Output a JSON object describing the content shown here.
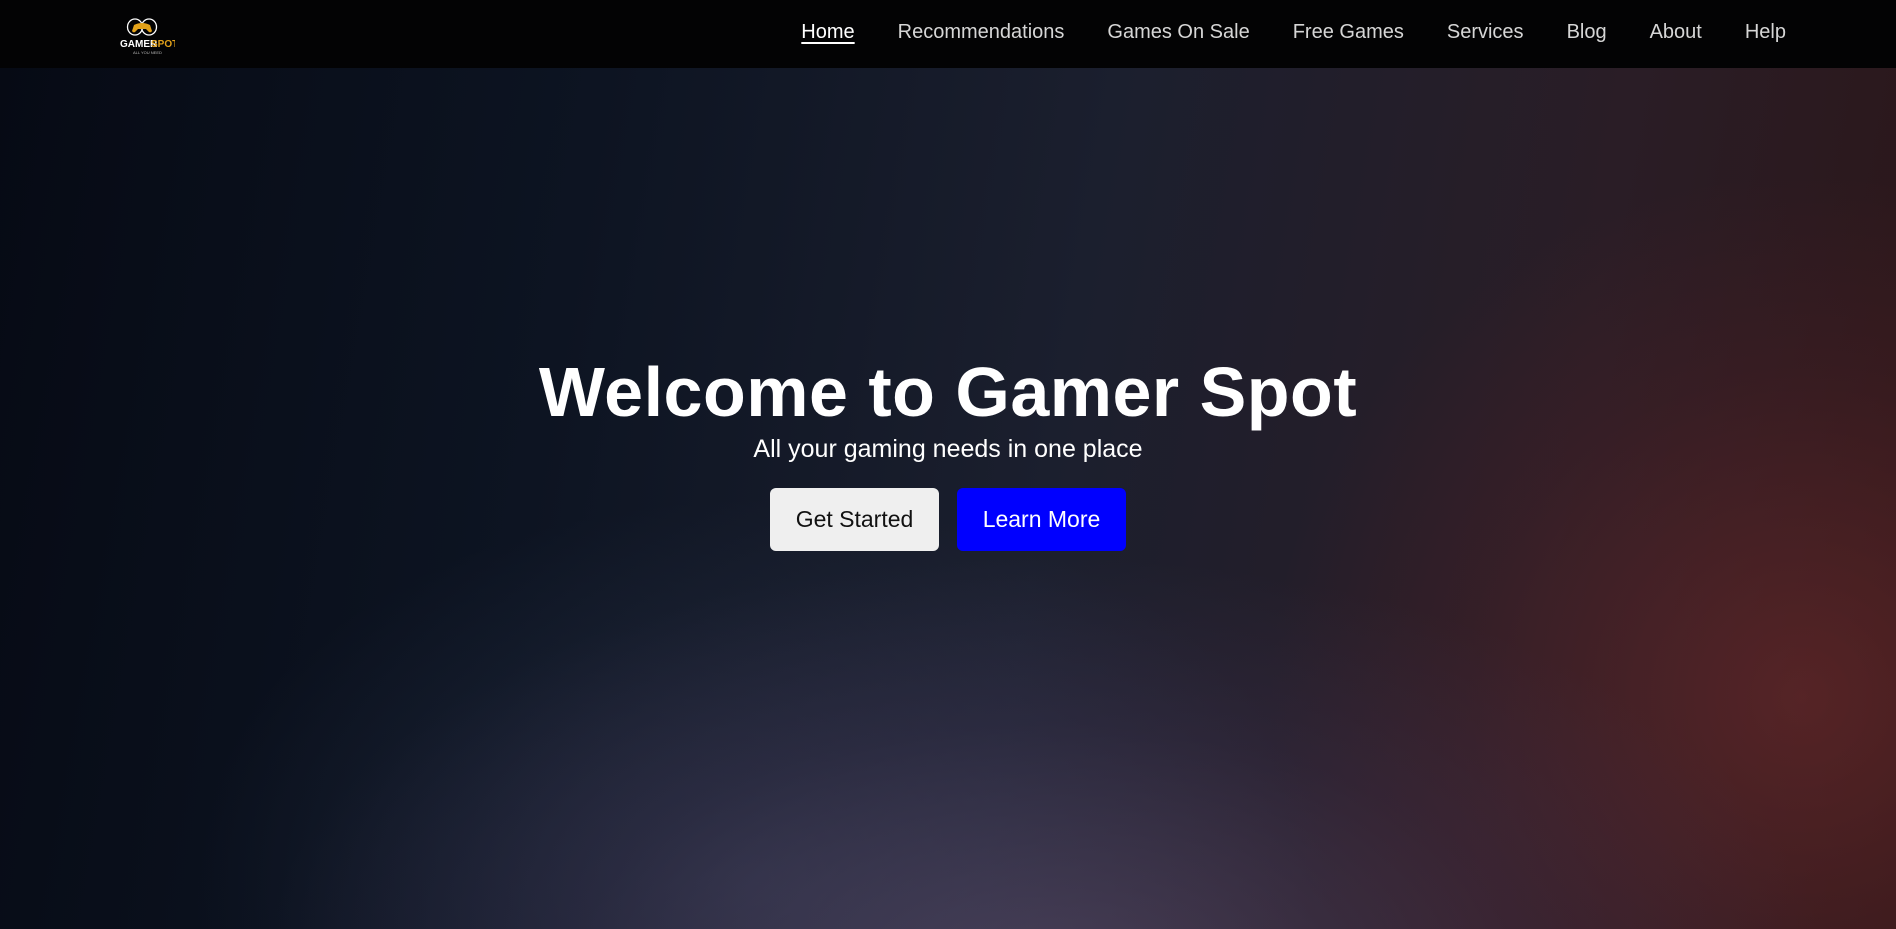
{
  "brand": {
    "logo_icon": "game-controller-icon",
    "logo_text_primary": "GAMER",
    "logo_text_accent": "SPOT",
    "logo_tagline": "ALL YOU NEED",
    "accent_color": "#e3a21a"
  },
  "nav": {
    "items": [
      {
        "label": "Home",
        "active": true
      },
      {
        "label": "Recommendations"
      },
      {
        "label": "Games On Sale"
      },
      {
        "label": "Free Games"
      },
      {
        "label": "Services"
      },
      {
        "label": "Blog"
      },
      {
        "label": "About"
      },
      {
        "label": "Help"
      }
    ]
  },
  "hero": {
    "title": "Welcome to Gamer Spot",
    "subtitle": "All your gaming needs in one place",
    "primary_button": "Get Started",
    "secondary_button": "Learn More",
    "secondary_button_color": "#0000ff"
  }
}
